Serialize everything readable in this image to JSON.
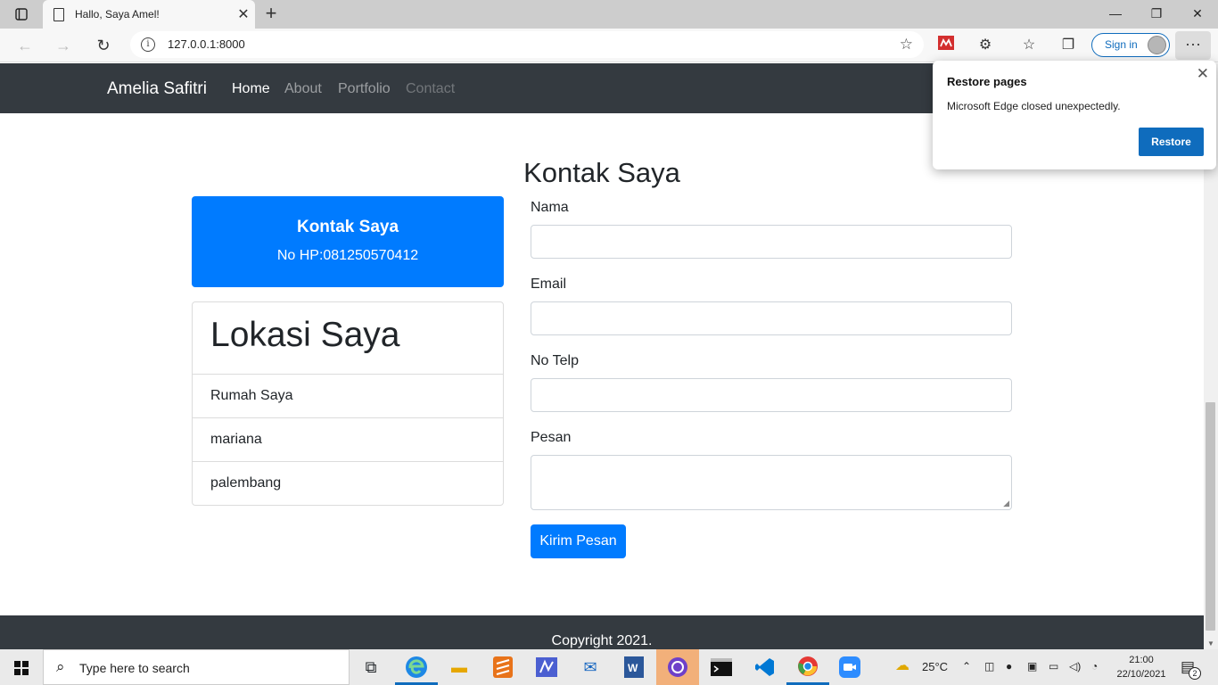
{
  "browser": {
    "tab_title": "Hallo, Saya Amel!",
    "tab_close": "✕",
    "new_tab": "+",
    "url": "127.0.0.1:8000",
    "sign_in": "Sign in",
    "more": "···",
    "minimize": "—",
    "restore": "❐",
    "close": "✕"
  },
  "site": {
    "brand": "Amelia Safitri",
    "nav": [
      "Home",
      "About",
      "Portfolio",
      "Contact"
    ],
    "active_nav": "Home",
    "page_title": "Kontak Saya",
    "contact_card": {
      "title": "Kontak Saya",
      "phone": "No HP:081250570412"
    },
    "location_card": {
      "title": "Lokasi Saya",
      "items": [
        "Rumah Saya",
        "mariana",
        "palembang"
      ]
    },
    "form": {
      "name_label": "Nama",
      "email_label": "Email",
      "phone_label": "No Telp",
      "message_label": "Pesan",
      "submit_label": "Kirim Pesan"
    },
    "footer": "Copyright 2021."
  },
  "popup": {
    "title": "Restore pages",
    "message": "Microsoft Edge closed unexpectedly.",
    "button": "Restore",
    "close": "✕"
  },
  "taskbar": {
    "search_placeholder": "Type here to search",
    "weather": "25°C",
    "time": "21:00",
    "date": "22/10/2021",
    "notification_count": "2"
  },
  "colors": {
    "navbar": "#343a40",
    "primary": "#007bff",
    "edge_accent": "#0f6cbd"
  }
}
